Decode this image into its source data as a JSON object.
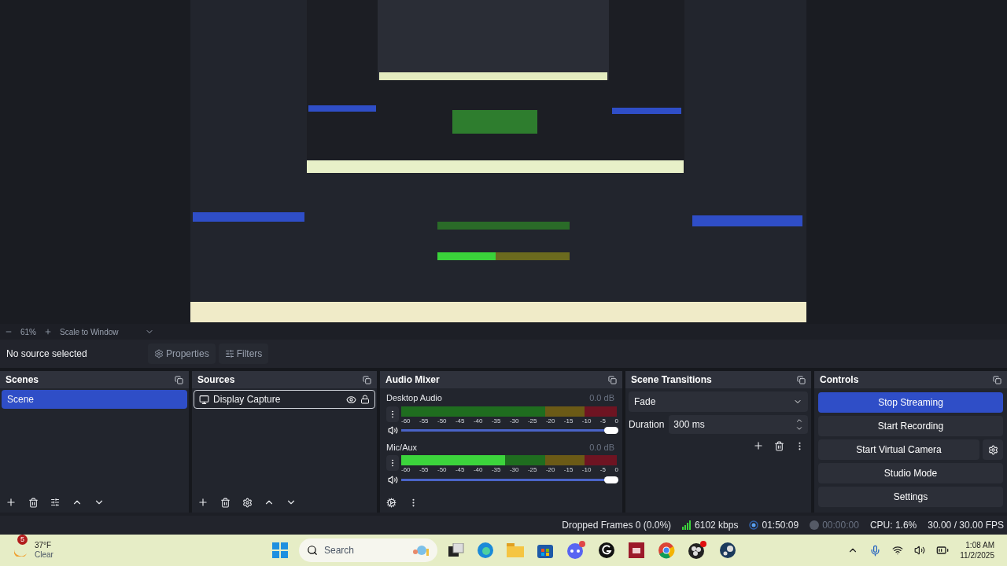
{
  "zoom_bar": {
    "zoom": "61%",
    "scale_mode": "Scale to Window"
  },
  "source_toolbar": {
    "label": "No source selected",
    "buttons": [
      "Properties",
      "Filters"
    ]
  },
  "scenes": {
    "title": "Scenes",
    "items": [
      {
        "label": "Scene",
        "selected": true
      }
    ]
  },
  "sources": {
    "title": "Sources",
    "items": [
      {
        "label": "Display Capture",
        "selected": true,
        "visible": true,
        "locked": true
      }
    ]
  },
  "audio_mixer": {
    "title": "Audio Mixer",
    "channels": [
      {
        "name": "Desktop Audio",
        "reading": "0.0 dB",
        "muted": false,
        "meter": {
          "level": 0
        },
        "volume": {
          "level": 1
        },
        "scale": [
          "-60",
          "-55",
          "-50",
          "-45",
          "-40",
          "-35",
          "-30",
          "-25",
          "-20",
          "-15",
          "-10",
          "-5",
          "0"
        ]
      },
      {
        "name": "Mic/Aux",
        "reading": "0.0 dB",
        "muted": false,
        "meter": {
          "level": 0.48
        },
        "volume": {
          "level": 1
        },
        "scale": [
          "-60",
          "-55",
          "-50",
          "-45",
          "-40",
          "-35",
          "-30",
          "-25",
          "-20",
          "-15",
          "-10",
          "-5",
          "0"
        ]
      }
    ]
  },
  "scene_transitions": {
    "title": "Scene Transitions",
    "transition": "Fade",
    "duration_label": "Duration",
    "duration": "300 ms"
  },
  "controls": {
    "title": "Controls",
    "buttons": [
      {
        "label": "Stop Streaming",
        "kind": "plain",
        "active": true
      },
      {
        "label": "Start Recording",
        "kind": "plain",
        "active": false
      },
      {
        "label": "Start Virtual Camera",
        "kind": "with_settings",
        "active": false
      },
      {
        "label": "Studio Mode",
        "kind": "plain",
        "active": false
      },
      {
        "label": "Settings",
        "kind": "plain",
        "active": false
      }
    ]
  },
  "status_bar": {
    "dropped": "Dropped Frames 0 (0.0%)",
    "bitrate": "6102 kbps",
    "stream_time": "01:50:09",
    "record_time": "00:00:00",
    "cpu": "CPU: 1.6%",
    "fps": "30.00 / 30.00 FPS"
  },
  "taskbar": {
    "weather": {
      "badge": "5",
      "temperature": "37°F",
      "condition": "Clear"
    },
    "search": {
      "placeholder": "Search"
    },
    "time": "1:08 AM",
    "date": "11/2/2025"
  }
}
